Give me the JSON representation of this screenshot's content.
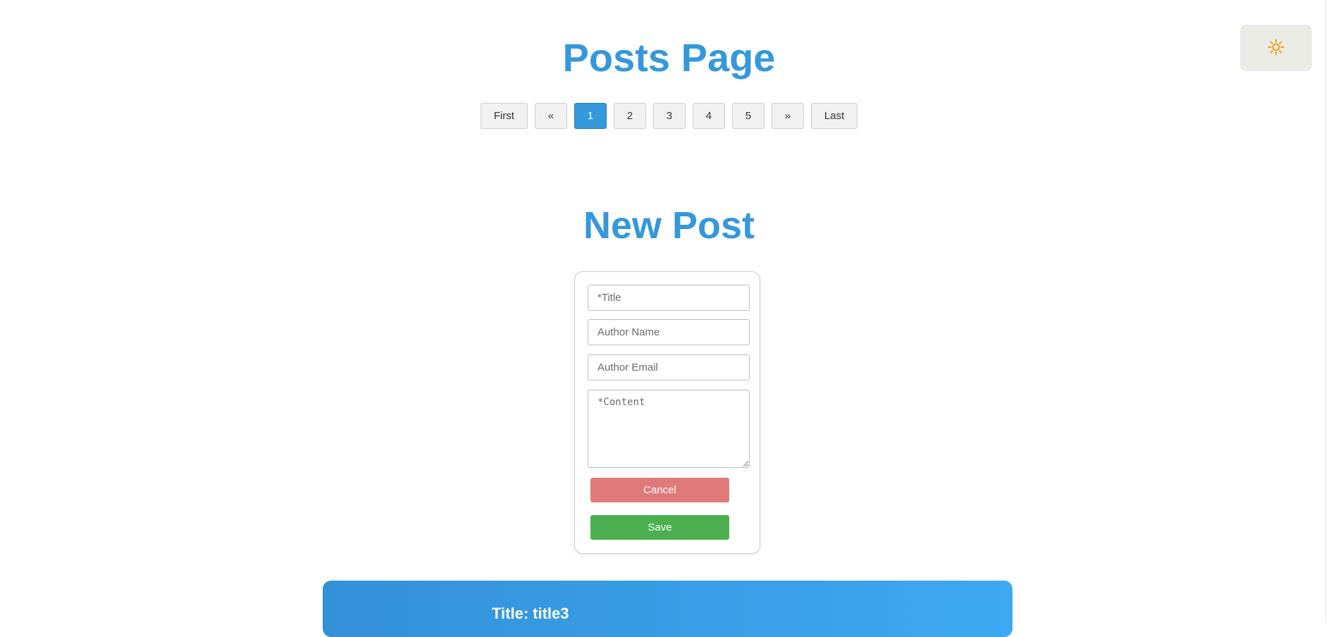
{
  "header": {
    "title": "Posts Page",
    "theme_toggle_icon": "sun-icon",
    "theme_toggle_color": "#f39c12"
  },
  "pagination": {
    "first_label": "First",
    "prev_label": "«",
    "pages": [
      "1",
      "2",
      "3",
      "4",
      "5"
    ],
    "current_page": "1",
    "next_label": "»",
    "last_label": "Last"
  },
  "new_post": {
    "heading": "New Post",
    "title_placeholder": "*Title",
    "author_name_placeholder": "Author Name",
    "author_email_placeholder": "Author Email",
    "content_placeholder": "*Content",
    "cancel_label": "Cancel",
    "save_label": "Save"
  },
  "posts": [
    {
      "title_label": "Title:",
      "title_value": "title3"
    }
  ],
  "colors": {
    "accent": "#3498db",
    "cancel": "#e07a7a",
    "save": "#4caf50"
  }
}
